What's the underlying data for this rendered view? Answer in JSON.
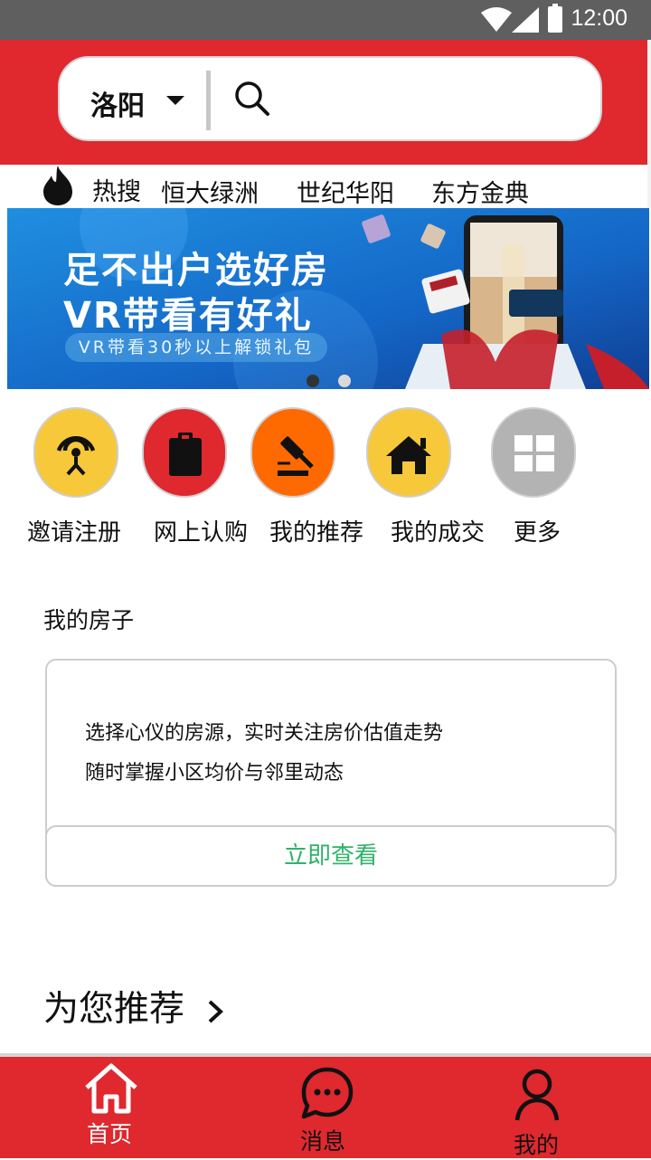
{
  "status_bar": {
    "time": "12:00"
  },
  "search": {
    "city": "洛阳"
  },
  "hot_search": {
    "label": "热搜",
    "items": [
      "恒大绿洲",
      "世纪华阳",
      "东方金典"
    ]
  },
  "banner": {
    "title_line1": "足不出户选好房",
    "title_line2": "VR带看有好礼",
    "subtitle": "VR带看30秒以上解锁礼包",
    "active_dot": 0
  },
  "quick_actions": [
    {
      "label": "邀请注册",
      "color": "#f7c83a",
      "icon": "signal-person-icon"
    },
    {
      "label": "网上认购",
      "color": "#e0282f",
      "icon": "clipboard-icon"
    },
    {
      "label": "我的推荐",
      "color": "#ff6a00",
      "icon": "gavel-icon"
    },
    {
      "label": "我的成交",
      "color": "#f7c83a",
      "icon": "house-icon"
    },
    {
      "label": "更多",
      "color": "#b3b3b3",
      "icon": "grid-icon"
    }
  ],
  "my_house": {
    "title": "我的房子",
    "line1": "选择心仪的房源，实时关注房价估值走势",
    "line2": "随时掌握小区均价与邻里动态",
    "button": "立即查看"
  },
  "recommend": {
    "title": "为您推荐"
  },
  "tabbar": {
    "home": "首页",
    "messages": "消息",
    "mine": "我的"
  },
  "colors": {
    "brand_red": "#e0282f",
    "accent_green": "#2fb36a"
  }
}
